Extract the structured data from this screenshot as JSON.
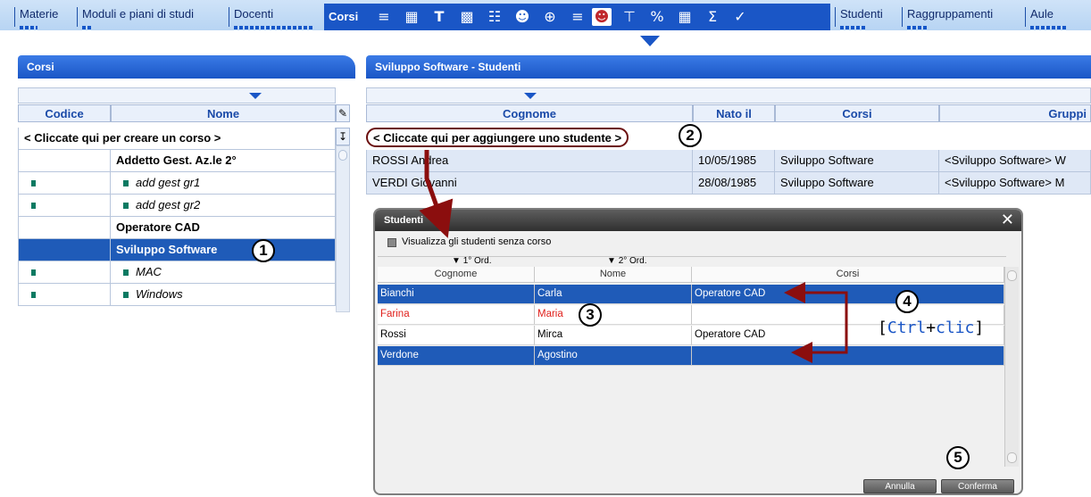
{
  "topnav": {
    "tabs_left": [
      "Materie",
      "Moduli e piani di studi",
      "Docenti"
    ],
    "active_tab": "Corsi",
    "tabs_right": [
      "Studenti",
      "Raggruppamenti",
      "Aule"
    ],
    "icons": [
      "list-icon",
      "grid-icon",
      "teacher-icon",
      "calendar-icon",
      "table-icon",
      "group-icon",
      "globe-icon",
      "lines-icon",
      "student-icon",
      "filter-icon",
      "percent-icon",
      "matrix-icon",
      "sigma-icon",
      "tag-icon"
    ]
  },
  "left_panel": {
    "title": "Corsi",
    "columns": [
      "Codice",
      "Nome"
    ],
    "create_row": "< Cliccate qui per creare un corso >",
    "rows": [
      {
        "name": "Addetto Gest. Az.le  2°",
        "bold": true,
        "marker": false,
        "italic": false
      },
      {
        "name": "add gest gr1",
        "bold": false,
        "marker": true,
        "italic": true
      },
      {
        "name": "add gest gr2",
        "bold": false,
        "marker": true,
        "italic": true
      },
      {
        "name": "Operatore CAD",
        "bold": true,
        "marker": false,
        "italic": false
      },
      {
        "name": "Sviluppo Software",
        "bold": true,
        "marker": false,
        "italic": false,
        "selected": true
      },
      {
        "name": "MAC",
        "bold": false,
        "marker": true,
        "italic": true
      },
      {
        "name": "Windows",
        "bold": false,
        "marker": true,
        "italic": true
      }
    ]
  },
  "right_panel": {
    "title": "Sviluppo Software - Studenti",
    "columns": [
      "Cognome",
      "Nato il",
      "Corsi",
      "Gruppi"
    ],
    "add_row": "< Cliccate qui per aggiungere uno studente >",
    "rows": [
      {
        "cognome": "ROSSI Andrea",
        "nato": "10/05/1985",
        "corsi": "Sviluppo Software",
        "gruppi": "<Sviluppo Software> W"
      },
      {
        "cognome": "VERDI Giovanni",
        "nato": "28/08/1985",
        "corsi": "Sviluppo Software",
        "gruppi": "<Sviluppo Software> M"
      }
    ]
  },
  "dialog": {
    "title": "Studenti",
    "checkbox_label": "Visualizza gli studenti senza corso",
    "sort1": "1° Ord.",
    "sort2": "2° Ord.",
    "columns": [
      "Cognome",
      "Nome",
      "Corsi"
    ],
    "rows": [
      {
        "cognome": "Bianchi",
        "nome": "Carla",
        "corsi": "Operatore CAD",
        "selected": true,
        "red": false
      },
      {
        "cognome": "Farina",
        "nome": "Maria",
        "corsi": "",
        "selected": false,
        "red": true
      },
      {
        "cognome": "Rossi",
        "nome": "Mirca",
        "corsi": "Operatore CAD",
        "selected": false,
        "red": false
      },
      {
        "cognome": "Verdone",
        "nome": "Agostino",
        "corsi": "",
        "selected": true,
        "red": false
      }
    ],
    "cancel_label": "Annulla",
    "confirm_label": "Conferma"
  },
  "annotations": {
    "callouts": [
      "1",
      "2",
      "3",
      "4",
      "5"
    ],
    "ctrl_hint": {
      "open": "[",
      "ctrl": "Ctrl",
      "plus": "+",
      "click": "clic",
      "close": "]"
    }
  },
  "colors": {
    "accent": "#1a56c6",
    "selection": "#1f5bb8",
    "annotation": "#8b0e0e",
    "hint": "#1a56c6"
  }
}
